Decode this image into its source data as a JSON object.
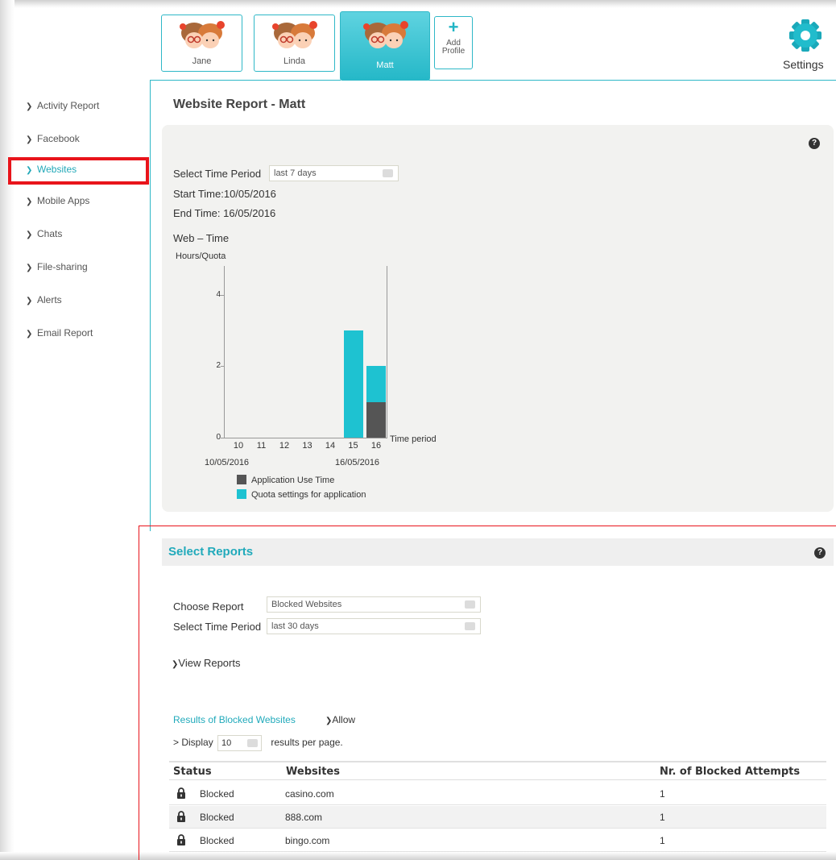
{
  "profiles": [
    {
      "name": "Jane",
      "active": false
    },
    {
      "name": "Linda",
      "active": false
    },
    {
      "name": "Matt",
      "active": true
    }
  ],
  "add_profile": {
    "line1": "Add",
    "line2": "Profile"
  },
  "settings_label": "Settings",
  "sidebar": {
    "items": [
      {
        "label": "Activity Report"
      },
      {
        "label": "Facebook"
      },
      {
        "label": "Websites",
        "active": true
      },
      {
        "label": "Mobile Apps"
      },
      {
        "label": "Chats"
      },
      {
        "label": "File-sharing"
      },
      {
        "label": "Alerts"
      },
      {
        "label": "Email Report"
      }
    ]
  },
  "page_title": "Website Report - Matt",
  "report": {
    "time_period_label": "Select Time Period",
    "time_period_value": "last 7 days",
    "start_time": "Start Time:10/05/2016",
    "end_time": "End Time: 16/05/2016",
    "web_time_label": "Web – Time"
  },
  "chart_data": {
    "type": "bar",
    "ylabel": "Hours/Quota",
    "xlabel": "Time period",
    "categories": [
      "10",
      "11",
      "12",
      "13",
      "14",
      "15",
      "16"
    ],
    "x_start_label": "10/05/2016",
    "x_end_label": "16/05/2016",
    "yticks": [
      "0",
      "2",
      "4"
    ],
    "ylim": [
      0,
      4.8
    ],
    "series": [
      {
        "name": "Quota settings for application",
        "color": "#1ec2d1",
        "values": [
          0,
          0,
          0,
          0,
          0,
          3,
          2
        ]
      },
      {
        "name": "Application Use Time",
        "color": "#555555",
        "values": [
          0,
          0,
          0,
          0,
          0,
          0,
          1
        ]
      }
    ]
  },
  "select_reports": {
    "title": "Select Reports",
    "choose_report_label": "Choose Report",
    "choose_report_value": "Blocked Websites",
    "time_period_label": "Select Time Period",
    "time_period_value": "last 30 days",
    "view_reports": "View Reports",
    "results_link": "Results of Blocked Websites",
    "allow_link": "Allow",
    "display_prefix": "> Display",
    "display_value": "10",
    "display_suffix": "results per page."
  },
  "table": {
    "headers": [
      "Status",
      "Websites",
      "Nr. of Blocked Attempts"
    ],
    "rows": [
      {
        "status": "Blocked",
        "website": "casino.com",
        "attempts": "1"
      },
      {
        "status": "Blocked",
        "website": "888.com",
        "attempts": "1"
      },
      {
        "status": "Blocked",
        "website": "bingo.com",
        "attempts": "1"
      }
    ]
  },
  "colors": {
    "accent": "#21aabb",
    "highlight": "#e8141b"
  }
}
